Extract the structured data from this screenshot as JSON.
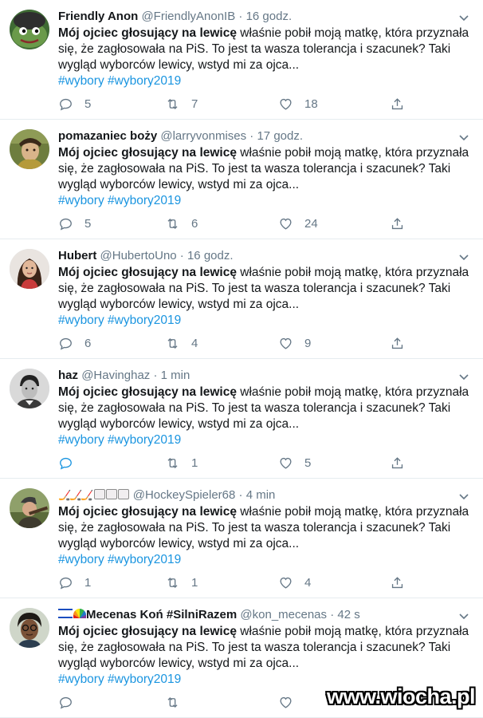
{
  "tweets": [
    {
      "name": "Friendly Anon",
      "handle": "@FriendlyAnonIB",
      "time": "16 godz.",
      "text_bold": "Mój ojciec głosujący na lewicę",
      "text_rest": " właśnie pobił moją matkę, która przyznała się, że zagłosowała na PiS. To jest ta wasza tolerancja i szacunek? Taki wygląd wyborców lewicy, wstyd mi za ojca...",
      "tags": "#wybory #wybory2019",
      "replies": "5",
      "retweets": "7",
      "likes": "18",
      "avatar": "frog-avatar"
    },
    {
      "name": "pomazaniec boży",
      "handle": "@larryvonmises",
      "time": "17 godz.",
      "text_bold": "Mój ojciec głosujący na lewicę",
      "text_rest": " właśnie pobił moją matkę, która przyznała się, że zagłosowała na PiS. To jest ta wasza tolerancja i szacunek? Taki wygląd wyborców lewicy, wstyd mi za ojca...",
      "tags": "#wybory #wybory2019",
      "replies": "5",
      "retweets": "6",
      "likes": "24",
      "avatar": "painting-avatar"
    },
    {
      "name": "Hubert",
      "handle": "@HubertoUno",
      "time": "16 godz.",
      "text_bold": "Mój ojciec głosujący na lewicę",
      "text_rest": " właśnie pobił moją matkę, która przyznała się, że zagłosowała na PiS. To jest ta wasza tolerancja i szacunek? Taki wygląd wyborców lewicy, wstyd mi za ojca...",
      "tags": "#wybory #wybory2019",
      "replies": "6",
      "retweets": "4",
      "likes": "9",
      "avatar": "woman-avatar"
    },
    {
      "name": "haz",
      "handle": "@Havinghaz",
      "time": "1 min",
      "text_bold": "Mój ojciec głosujący na lewicę",
      "text_rest": " właśnie pobił moją matkę, która przyznała się, że zagłosowała na PiS. To jest ta wasza tolerancja i szacunek? Taki wygląd wyborców lewicy, wstyd mi za ojca...",
      "tags": "#wybory #wybory2019",
      "replies": "",
      "retweets": "1",
      "likes": "5",
      "avatar": "portrait-avatar"
    },
    {
      "name": "",
      "handle": "@HockeySpieler68",
      "time": "4 min",
      "text_bold": "Mój ojciec głosujący na lewicę",
      "text_rest": " właśnie pobił moją matkę, która przyznała się, że zagłosowała na PiS. To jest ta wasza tolerancja i szacunek? Taki wygląd wyborców lewicy, wstyd mi za ojca...",
      "tags": "#wybory #wybory2019",
      "replies": "1",
      "retweets": "1",
      "likes": "4",
      "avatar": "hunter-avatar"
    },
    {
      "name": "Mecenas Koń #SilniRazem",
      "handle": "@kon_mecenas",
      "time": "42 s",
      "text_bold": "Mój ojciec głosujący na lewicę",
      "text_rest": " właśnie pobił moją matkę, która przyznała się, że zagłosowała na PiS. To jest ta wasza tolerancja i szacunek? Taki wygląd wyborców lewicy, wstyd mi za ojca...",
      "tags": "#wybory #wybory2019",
      "replies": "",
      "retweets": "",
      "likes": "",
      "avatar": "man-avatar"
    }
  ],
  "separator": "·",
  "watermark": "www.wiocha.pl",
  "colors": {
    "link": "#1b95e0",
    "muted": "#657786",
    "text": "#14171a",
    "divider": "#e6ecf0"
  }
}
